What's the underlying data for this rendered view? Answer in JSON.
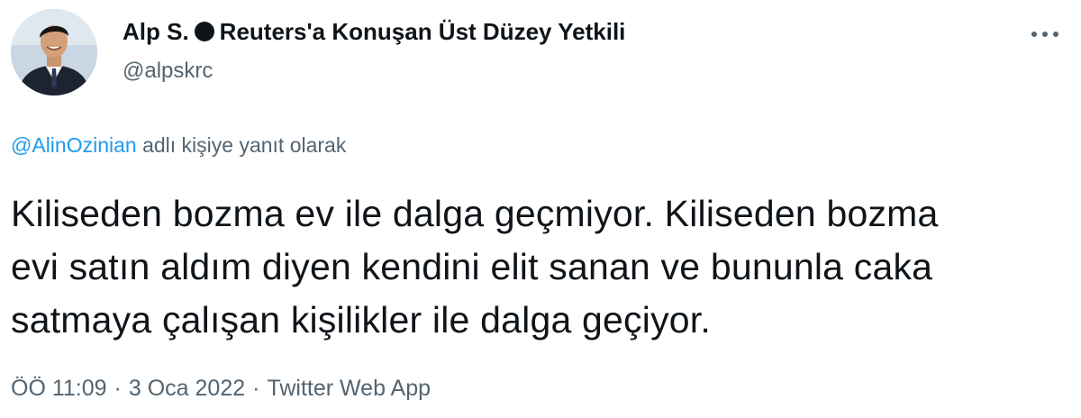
{
  "tweet": {
    "author": {
      "name_part1": "Alp S.",
      "name_part2": "Reuters'a Konuşan Üst Düzey Yetkili",
      "handle": "@alpskrc"
    },
    "reply": {
      "mention": "@AlinOzinian",
      "suffix": "adlı kişiye yanıt olarak"
    },
    "text_lines": [
      "Kiliseden bozma ev ile dalga geçmiyor. Kiliseden bozma",
      "evi satın aldım diyen kendini elit sanan ve bununla caka",
      "satmaya çalışan kişilikler ile dalga geçiyor."
    ],
    "meta": {
      "time": "ÖÖ 11:09",
      "separator": "·",
      "date": "3 Oca 2022",
      "source": "Twitter Web App"
    }
  },
  "icons": {
    "more": "more-horizontal-icon",
    "name_dot": "black-circle-icon"
  },
  "colors": {
    "text": "#0f1419",
    "secondary": "#536471",
    "link": "#1d9bf0"
  }
}
